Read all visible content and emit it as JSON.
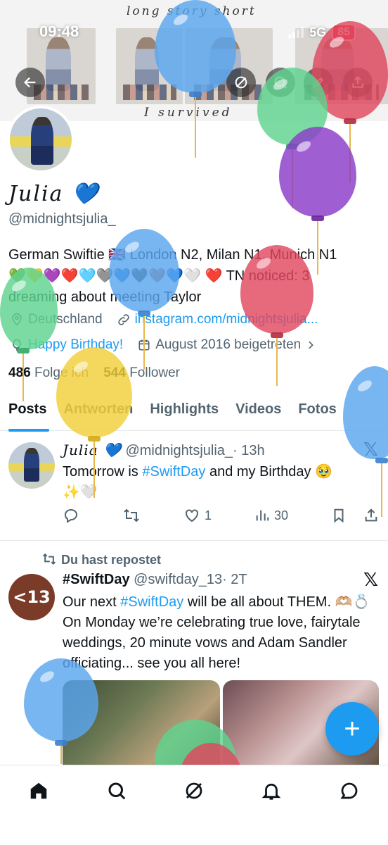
{
  "status_bar": {
    "time": "09:48",
    "network": "5G",
    "battery": "85"
  },
  "banner": {
    "caption_top": "long story short",
    "caption_bottom": "I survived"
  },
  "profile": {
    "name": "Julia 💙",
    "handle": "@midnightsjulia_",
    "bio_line1": "German Swiftie 🇬🇧 London N2, Milan N1, Munich N1",
    "bio_line2": "💚💛💜❤️🩵🩶💙🖤🤎💙🤍 ❤️ TN noticed: 3",
    "bio_line3": "dreaming about meeting Taylor",
    "location": "Deutschland",
    "link": "instagram.com/midnightsjulia...",
    "birthday": "Happy Birthday!",
    "joined": "August 2016 beigetreten",
    "following_count": "486",
    "following_label": "Folge ich",
    "followers_count": "544",
    "followers_label": "Follower"
  },
  "tabs": [
    "Posts",
    "Antworten",
    "Highlights",
    "Videos",
    "Fotos"
  ],
  "post1": {
    "name": "Julia 💙",
    "handle": "@midnightsjulia_",
    "time": "· 13h",
    "text_before": "Tomorrow is ",
    "hashtag": "#SwiftDay",
    "text_after": " and my Birthday 🥹",
    "text_line2": "✨🤍",
    "likes": "1",
    "views": "30"
  },
  "repost_note": "Du hast repostet",
  "post2": {
    "avatar_text": "<13",
    "name": "#SwiftDay",
    "handle": "@swiftday_13",
    "time": "· 2T",
    "text_before": "Our next ",
    "hashtag": "#SwiftDay",
    "text_after": " will be all about THEM.",
    "text_rest": "🫶🏼💍 On Monday we’re celebrating true love, fairytale weddings, 20 minute vows and Adam Sandler officiating... see you all here!"
  },
  "fab_label": "+",
  "icons": [
    "back-icon",
    "circle-slash-icon",
    "search-icon",
    "edit-icon",
    "share-icon",
    "location-icon",
    "link-icon",
    "balloon-icon",
    "calendar-icon",
    "chevron-right-icon",
    "x-logo-icon",
    "reply-icon",
    "repost-icon",
    "like-icon",
    "views-icon",
    "bookmark-icon",
    "home-icon",
    "notifications-icon",
    "messages-icon"
  ],
  "colors": {
    "accent": "#1d9bf0",
    "text": "#0f1419",
    "muted": "#536471"
  }
}
